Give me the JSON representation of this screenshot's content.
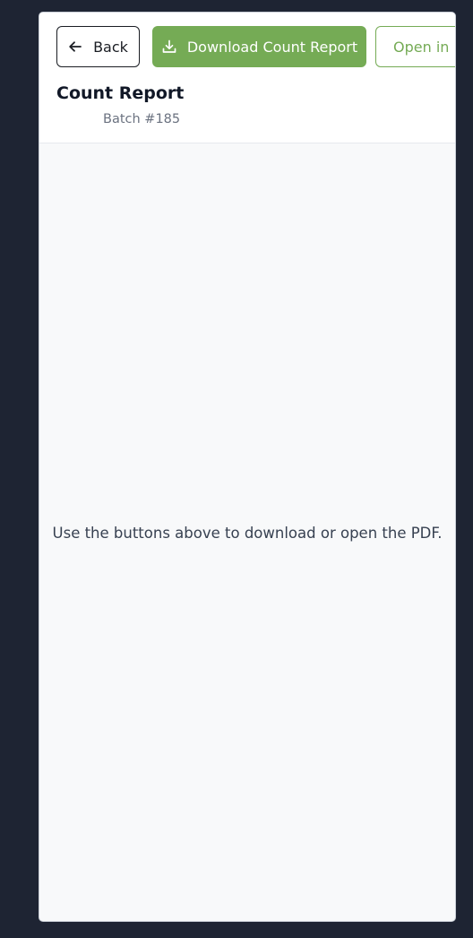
{
  "toolbar": {
    "back_label": "Back",
    "download_label": "Download Count Report",
    "open_label": "Open in New Tab"
  },
  "header": {
    "title": "Count Report",
    "subtitle": "Batch #185"
  },
  "viewer": {
    "message": "Use the buttons above to download or open the PDF."
  },
  "icons": {
    "back": "arrow-left-icon",
    "download": "download-icon"
  },
  "colors": {
    "accent": "#75ab55",
    "background": "#1e2433"
  }
}
